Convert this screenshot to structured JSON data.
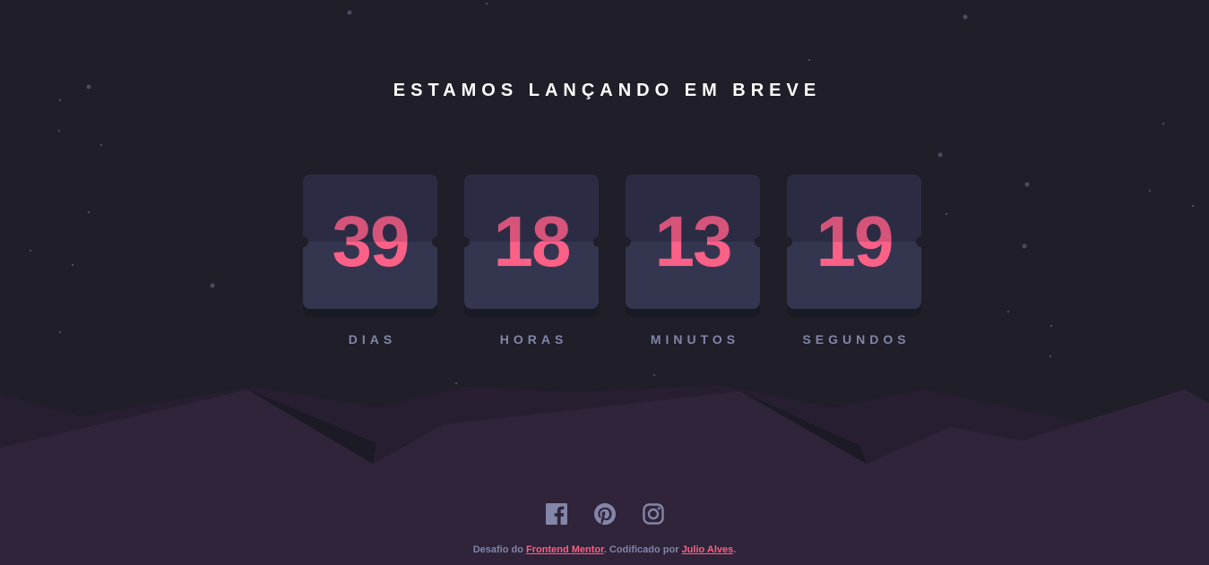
{
  "page": {
    "title": "ESTAMOS LANÇANDO EM BREVE"
  },
  "countdown": [
    {
      "value": "39",
      "label": "DIAS"
    },
    {
      "value": "18",
      "label": "HORAS"
    },
    {
      "value": "13",
      "label": "MINUTOS"
    },
    {
      "value": "19",
      "label": "SEGUNDOS"
    }
  ],
  "social": [
    {
      "name": "facebook-icon"
    },
    {
      "name": "pinterest-icon"
    },
    {
      "name": "instagram-icon"
    }
  ],
  "footer": {
    "prefix": "Desafio do ",
    "challenge_link": "Frontend Mentor",
    "middle": ". Codificado por ",
    "author_link": "Julio Alves",
    "suffix": "."
  },
  "colors": {
    "background": "#1f1e29",
    "card": "#343650",
    "card_top": "#2b2c44",
    "accent": "#fb6087",
    "label": "#8385a9",
    "hills": "#2f2439"
  }
}
